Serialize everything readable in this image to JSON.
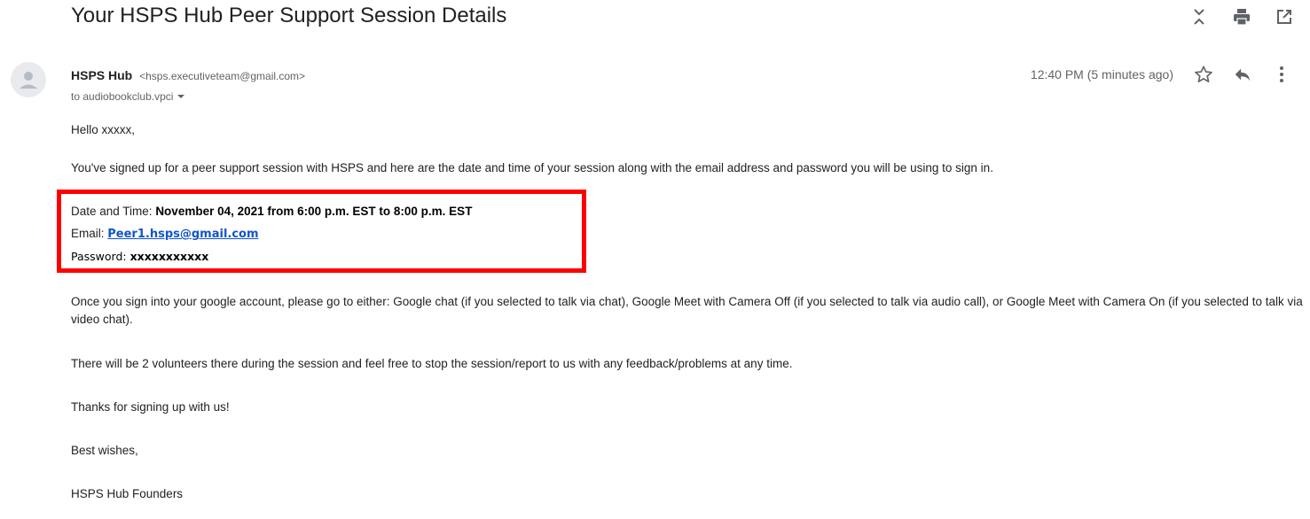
{
  "subject": "Your HSPS Hub Peer Support Session Details",
  "toolbar": {
    "icons": [
      "collapse-icon",
      "print-icon",
      "open-in-new-window-icon"
    ]
  },
  "sender": {
    "name": "HSPS Hub",
    "email": "<hsps.executiveteam@gmail.com>",
    "to": "to audiobookclub.vpci"
  },
  "meta": {
    "time": "12:40 PM (5 minutes ago)",
    "icons": [
      "star-icon",
      "reply-icon",
      "more-options-icon"
    ]
  },
  "body": {
    "greeting": "Hello xxxxx,",
    "intro": "You've signed up for a peer support session with HSPS and here are the date and time of your session along with the email address and password you will be using to sign in.",
    "details": {
      "date_label": "Date and Time: ",
      "date_value": "November 04, 2021 from 6:00 p.m. EST to 8:00 p.m. EST",
      "email_label": "Email: ",
      "email_value": "Peer1.hsps@gmail.com",
      "password_label": "Password: ",
      "password_value": "xxxxxxxxxxx"
    },
    "instructions": "Once you sign into your google account, please go to either: Google chat (if you selected to talk via chat), Google Meet with Camera Off (if you selected to talk via audio call), or Google Meet with Camera On (if you selected to talk via video chat).",
    "volunteers": "There will be 2 volunteers there during the session and feel free to stop the session/report to us with any feedback/problems at any time.",
    "thanks": "Thanks for signing up with us!",
    "closing": "Best wishes,",
    "signature": "HSPS Hub Founders"
  },
  "colors": {
    "highlight_box": "#ff0000",
    "link": "#1155cc",
    "secondary_text": "#5f6368"
  }
}
